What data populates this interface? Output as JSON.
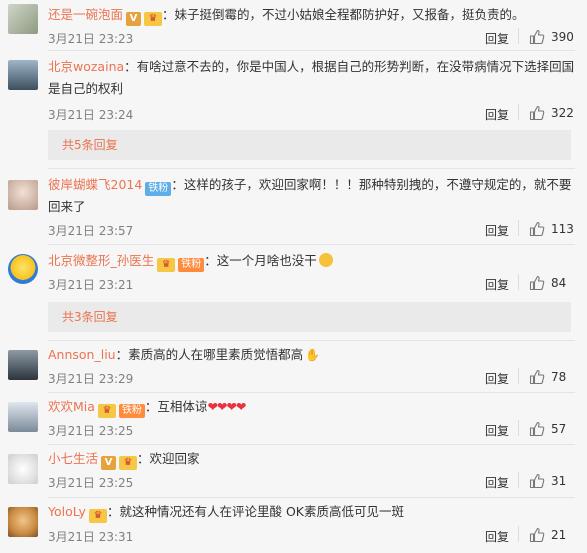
{
  "comments": [
    {
      "user": "还是一碗泡面",
      "text": "：妹子挺倒霉的，不过小姑娘全程都防护好，又报备，挺负责的。",
      "time": "3月21日 23:23",
      "reply": "回复",
      "likes": "390"
    },
    {
      "user": "北京wozaina",
      "text": "：有啥过意不去的，你是中国人，根据自己的形势判断，在没带病情况下选择回国是自己的权利",
      "time": "3月21日 23:24",
      "reply": "回复",
      "likes": "322",
      "more": "共5条回复"
    },
    {
      "user": "彼岸蝴蝶飞2014",
      "badge": "铁粉",
      "text": "：这样的孩子，欢迎回家啊！！！那种特别拽的，不遵守规定的，就不要回来了",
      "time": "3月21日 23:57",
      "reply": "回复",
      "likes": "113"
    },
    {
      "user": "北京微整形_孙医生",
      "badge": "铁粉",
      "text": "：这一个月啥也没干",
      "time": "3月21日 23:21",
      "reply": "回复",
      "likes": "84",
      "more": "共3条回复"
    },
    {
      "user": "Annson_liu",
      "text": "：素质高的人在哪里素质觉悟都高",
      "time": "3月21日 23:29",
      "reply": "回复",
      "likes": "78"
    },
    {
      "user": "欢欢Mia",
      "badge": "铁粉",
      "text": "：互相体谅",
      "time": "3月21日 23:25",
      "reply": "回复",
      "likes": "57"
    },
    {
      "user": "小七生活",
      "text": "：欢迎回家",
      "time": "3月21日 23:25",
      "reply": "回复",
      "likes": "31"
    },
    {
      "user": "YoloLy",
      "text": "：就这种情况还有人在评论里酸 OK素质高低可见一斑",
      "time": "3月21日 23:31",
      "reply": "回复",
      "likes": "21"
    }
  ],
  "icons": {
    "like": "thumbs-up-icon",
    "vip": "vip-crown-icon",
    "verified": "verified-v-icon"
  },
  "colors": {
    "username": "#eb7350",
    "heart": "#e8323c",
    "iron_badge": "#5dade8",
    "fan_badge": "#ff8b3d"
  }
}
